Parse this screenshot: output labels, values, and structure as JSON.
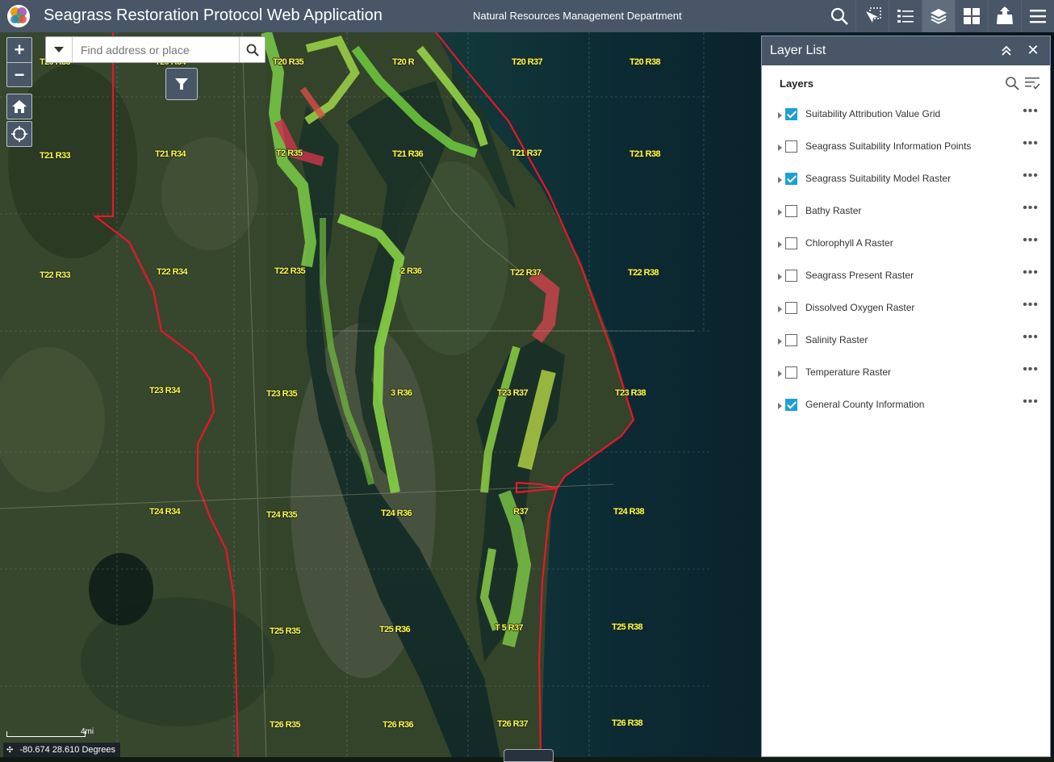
{
  "header": {
    "title": "Seagrass Restoration Protocol Web Application",
    "subtitle": "Natural Resources Management Department",
    "tools": [
      {
        "name": "search-tool",
        "icon": "magnifier-icon"
      },
      {
        "name": "select-tool",
        "icon": "select-cursor-icon"
      },
      {
        "name": "legend-tool",
        "icon": "legend-list-icon"
      },
      {
        "name": "layer-list-tool",
        "icon": "layers-stack-icon",
        "active": true
      },
      {
        "name": "basemap-gallery-tool",
        "icon": "grid-icon"
      },
      {
        "name": "print-tool",
        "icon": "map-export-icon"
      },
      {
        "name": "menu-tool",
        "icon": "hamburger-menu-icon"
      }
    ],
    "colors": {
      "bar": "#485667",
      "active": "#5f6d7d"
    }
  },
  "map": {
    "search_placeholder": "Find address or place",
    "coordinates": "-80.674 28.610 Degrees",
    "scale_label": "4mi",
    "township_labels": [
      "T20 R33",
      "T20 R34",
      "T20 R35",
      "T20 R",
      "T20 R37",
      "T20 R38",
      "T21 R33",
      "T21 R34",
      "T2 R35",
      "T21 R36",
      "T21 R37",
      "T21 R38",
      "T22 R33",
      "T22 R34",
      "T22 R35",
      "2 R36",
      "T22 R37",
      "T22 R38",
      "T23 R34",
      "T23 R35",
      "3 R36",
      "T23 R37",
      "T23 R38",
      "T24 R34",
      "T24 R35",
      "T24 R36",
      "R37",
      "T24 R38",
      "T25 R35",
      "T25 R36",
      "T 5 R37",
      "T25 R38",
      "T26 R35",
      "T26 R36",
      "T26 R37",
      "T26 R38"
    ],
    "label_color": "#f7ff44",
    "boundary_color": "#e8162b"
  },
  "panel": {
    "title": "Layer List",
    "section_title": "Layers",
    "layers": [
      {
        "label": "Suitability Attribution Value Grid",
        "checked": true
      },
      {
        "label": "Seagrass Suitability Information Points",
        "checked": false
      },
      {
        "label": "Seagrass Suitability Model Raster",
        "checked": true
      },
      {
        "label": "Bathy Raster",
        "checked": false
      },
      {
        "label": "Chlorophyll A Raster",
        "checked": false
      },
      {
        "label": "Seagrass Present Raster",
        "checked": false
      },
      {
        "label": "Dissolved Oxygen Raster",
        "checked": false
      },
      {
        "label": "Salinity Raster",
        "checked": false
      },
      {
        "label": "Temperature Raster",
        "checked": false
      },
      {
        "label": "General County Information",
        "checked": true
      }
    ],
    "more_glyph": "•••",
    "check_color": "#1d9fd5"
  }
}
